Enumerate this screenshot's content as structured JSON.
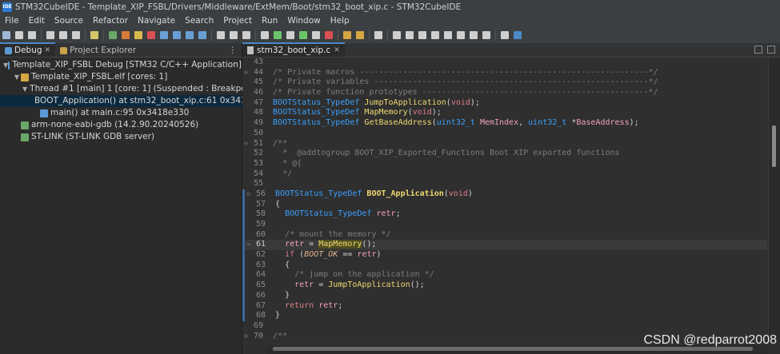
{
  "window": {
    "title": "STM32CubeIDE - Template_XIP_FSBL/Drivers/Middleware/ExtMem/Boot/stm32_boot_xip.c - STM32CubeIDE",
    "icon": "ide-icon"
  },
  "menu": [
    "File",
    "Edit",
    "Source",
    "Refactor",
    "Navigate",
    "Search",
    "Project",
    "Run",
    "Window",
    "Help"
  ],
  "left_tabs": [
    {
      "label": "Debug"
    },
    {
      "label": "Project Explorer"
    }
  ],
  "tree": [
    {
      "label": "Template_XIP_FSBL Debug [STM32 C/C++ Application]",
      "indent": 0,
      "arrow": "v"
    },
    {
      "label": "Template_XIP_FSBL.elf [cores: 1]",
      "indent": 1,
      "arrow": "v"
    },
    {
      "label": "Thread #1 [main] 1 [core: 1] (Suspended : Breakpoint)",
      "indent": 2,
      "arrow": "v"
    },
    {
      "label": "BOOT_Application() at stm32_boot_xip.c:61 0x34180792",
      "indent": 3,
      "arrow": ""
    },
    {
      "label": "main() at main.c:95 0x3418e330",
      "indent": 3,
      "arrow": ""
    },
    {
      "label": "arm-none-eabi-gdb (14.2.90.20240526)",
      "indent": 1,
      "arrow": ""
    },
    {
      "label": "ST-LINK (ST-LINK GDB server)",
      "indent": 1,
      "arrow": ""
    }
  ],
  "editor": {
    "tab_label": "stm32_boot_xip.c",
    "current_line": "61",
    "lines": [
      {
        "n": "43",
        "t": []
      },
      {
        "n": "44",
        "t": [
          [
            "cm",
            "/* Private macros ------------------------------------------------------------*/"
          ]
        ]
      },
      {
        "n": "45",
        "t": [
          [
            "cm",
            "/* Private variables ---------------------------------------------------------*/"
          ]
        ]
      },
      {
        "n": "46",
        "t": [
          [
            "cm",
            "/* Private function prototypes -----------------------------------------------*/"
          ]
        ]
      },
      {
        "n": "47",
        "t": [
          [
            "ty",
            "BOOTStatus_TypeDef "
          ],
          [
            "fn",
            "JumpToApplication"
          ],
          [
            "pl",
            "("
          ],
          [
            "kw",
            "void"
          ],
          [
            "pl",
            ");"
          ]
        ]
      },
      {
        "n": "48",
        "t": [
          [
            "ty",
            "BOOTStatus_TypeDef "
          ],
          [
            "fn",
            "MapMemory"
          ],
          [
            "pl",
            "("
          ],
          [
            "kw",
            "void"
          ],
          [
            "pl",
            ");"
          ]
        ]
      },
      {
        "n": "49",
        "t": [
          [
            "ty",
            "BOOTStatus_TypeDef "
          ],
          [
            "fn",
            "GetBaseAddress"
          ],
          [
            "pl",
            "("
          ],
          [
            "ty",
            "uint32_t "
          ],
          [
            "id",
            "MemIndex"
          ],
          [
            "pl",
            ", "
          ],
          [
            "ty",
            "uint32_t "
          ],
          [
            "pl",
            "*"
          ],
          [
            "id",
            "BaseAddress"
          ],
          [
            "pl",
            ");"
          ]
        ]
      },
      {
        "n": "50",
        "t": []
      },
      {
        "n": "51",
        "t": [
          [
            "cm",
            "/**"
          ]
        ]
      },
      {
        "n": "52",
        "t": [
          [
            "cm",
            "  *  @addtogroup BOOT_XIP_Exported_Functions Boot XIP exported functions"
          ]
        ]
      },
      {
        "n": "53",
        "t": [
          [
            "cm",
            "  * @{"
          ]
        ]
      },
      {
        "n": "54",
        "t": [
          [
            "cm",
            "  */"
          ]
        ]
      },
      {
        "n": "55",
        "t": []
      },
      {
        "n": "56",
        "t": [
          [
            "ty",
            "BOOTStatus_TypeDef "
          ],
          [
            "fnb",
            "BOOT_Application"
          ],
          [
            "pl",
            "("
          ],
          [
            "kw",
            "void"
          ],
          [
            "pl",
            ")"
          ]
        ]
      },
      {
        "n": "57",
        "t": [
          [
            "pl",
            "{"
          ]
        ]
      },
      {
        "n": "58",
        "t": [
          [
            "pl",
            "  "
          ],
          [
            "ty",
            "BOOTStatus_TypeDef "
          ],
          [
            "id",
            "retr"
          ],
          [
            "pl",
            ";"
          ]
        ]
      },
      {
        "n": "59",
        "t": []
      },
      {
        "n": "60",
        "t": [
          [
            "cm",
            "  /* mount the memory */"
          ]
        ]
      },
      {
        "n": "61",
        "t": [
          [
            "pl",
            "  "
          ],
          [
            "id",
            "retr"
          ],
          [
            "pl",
            " = "
          ],
          [
            "fnh",
            "MapMemory"
          ],
          [
            "pl",
            "();"
          ]
        ]
      },
      {
        "n": "62",
        "t": [
          [
            "pl",
            "  "
          ],
          [
            "kw",
            "if"
          ],
          [
            "pl",
            " ("
          ],
          [
            "it",
            "BOOT_OK"
          ],
          [
            "pl",
            " == "
          ],
          [
            "id",
            "retr"
          ],
          [
            "pl",
            ")"
          ]
        ]
      },
      {
        "n": "63",
        "t": [
          [
            "pl",
            "  {"
          ]
        ]
      },
      {
        "n": "64",
        "t": [
          [
            "cm",
            "    /* jump on the application */"
          ]
        ]
      },
      {
        "n": "65",
        "t": [
          [
            "pl",
            "    "
          ],
          [
            "id",
            "retr"
          ],
          [
            "pl",
            " = "
          ],
          [
            "fn",
            "JumpToApplication"
          ],
          [
            "pl",
            "();"
          ]
        ]
      },
      {
        "n": "66",
        "t": [
          [
            "pl",
            "  }"
          ]
        ]
      },
      {
        "n": "67",
        "t": [
          [
            "pl",
            "  "
          ],
          [
            "kw",
            "return"
          ],
          [
            "pl",
            " "
          ],
          [
            "id",
            "retr"
          ],
          [
            "pl",
            ";"
          ]
        ]
      },
      {
        "n": "68",
        "t": [
          [
            "pl",
            "}"
          ]
        ]
      },
      {
        "n": "69",
        "t": []
      },
      {
        "n": "70",
        "t": [
          [
            "cm",
            "/**"
          ]
        ]
      }
    ]
  },
  "watermark": "CSDN @redparrot2008",
  "colors": {
    "accent": "#4a88c7",
    "selection": "#0d293e",
    "current_line": "#3a3a3a"
  }
}
